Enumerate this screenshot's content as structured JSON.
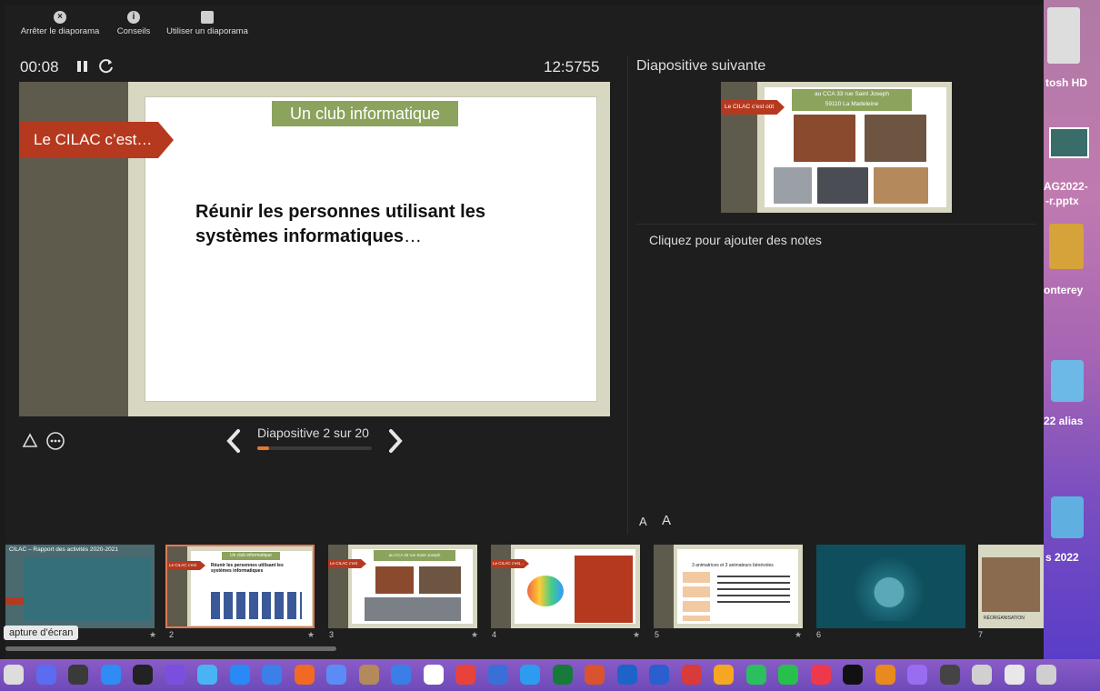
{
  "toolbar": {
    "stop_label": "Arrêter le diaporama",
    "tips_label": "Conseils",
    "use_display_label": "Utiliser un diaporama"
  },
  "timer": {
    "elapsed": "00:08",
    "clock": "12:5755"
  },
  "current_slide": {
    "title": "Un club informatique",
    "arrow_text": "Le CILAC c’est…",
    "body_line1": "Réunir les personnes utilisant les",
    "body_line2_bold": "systèmes informatiques",
    "body_line2_tail": "…"
  },
  "navigation": {
    "label": "Diapositive 2 sur 20",
    "progress": 0.1
  },
  "next_slide": {
    "header": "Diapositive suivante",
    "arrow_text": "Le CILAC c’est oût",
    "address_line1": "au CCA 33 rue Saint Joseph",
    "address_line2": "59110 La Madeleine"
  },
  "notes": {
    "placeholder": "Cliquez pour ajouter des notes",
    "font_small": "A",
    "font_large": "A"
  },
  "filmstrip": [
    {
      "number": "",
      "caption": "CILAC – Rapport des activités 2020-2021"
    },
    {
      "number": "2",
      "caption": "Un club informatique",
      "subtitle": "Réunir les personnes utilisant les systèmes informatiques"
    },
    {
      "number": "3",
      "caption": "au CCA 33 rue Saint Joseph"
    },
    {
      "number": "4",
      "caption": "Le CILAC c’est…"
    },
    {
      "number": "5",
      "caption": "3 animatrices et 3 animateurs bénévoles"
    },
    {
      "number": "6",
      "caption": ""
    },
    {
      "number": "7",
      "caption": "RÉORGANISATION"
    }
  ],
  "tooltip": "apture d’écran",
  "desktop": {
    "labels": [
      "tosh HD",
      "AG2022-",
      "-r.pptx",
      "onterey",
      "22 alias",
      "s 2022"
    ]
  },
  "colors": {
    "accent": "#b5391f",
    "title_green": "#8ba35c",
    "band": "#5e5a4c",
    "progress": "#e07a2f"
  }
}
